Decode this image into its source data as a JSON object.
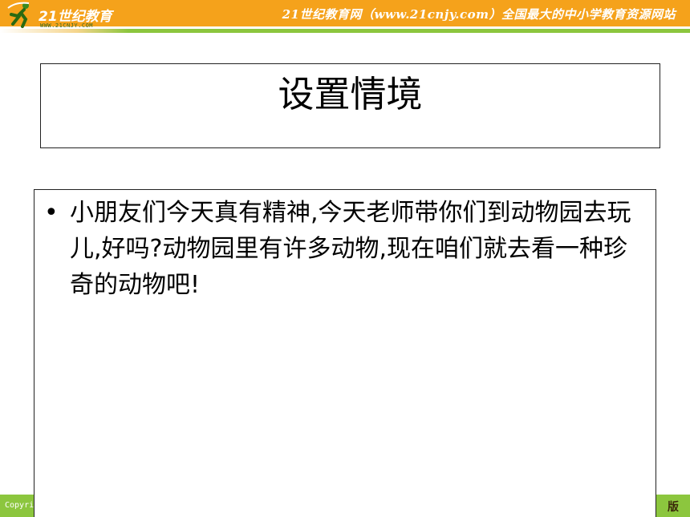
{
  "header": {
    "logo_brand": "21世纪教育",
    "logo_url": "WWW.21CNJY.COM",
    "site_slogan": "21世纪教育网（www.21cnjy.com）全国最大的中小学教育资源网站"
  },
  "slide": {
    "title": "设置情境",
    "bullets": [
      {
        "text": "小朋友们今天真有精神,今天老师带你们到动物园去玩儿,好吗?动物园里有许多动物,现在咱们就去看一种珍奇的动物吧!"
      }
    ]
  },
  "footer": {
    "copyright": "Copyri",
    "edition": "版"
  },
  "colors": {
    "header_orange": "#f5a21b",
    "accent_green": "#8cc63e"
  }
}
